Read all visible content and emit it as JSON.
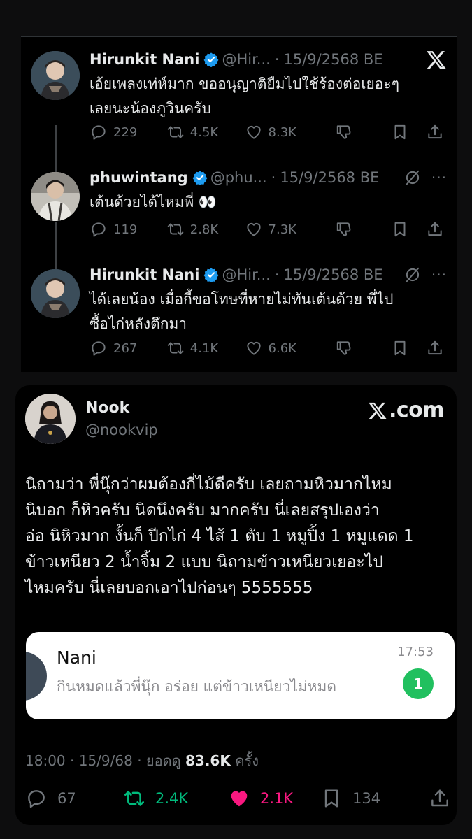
{
  "thread": {
    "tweets": [
      {
        "name": "Hirunkit Nani",
        "handle": "@Hir...",
        "date": "15/9/2568 BE",
        "text_lines": [
          "เอ้ยเพลงเท่ห์มาก ขออนุญาติยืมไปใช้ร้องต่อเยอะๆ",
          "เลยนะน้องภูวินครับ"
        ],
        "replies": "229",
        "reposts": "4.5K",
        "likes": "8.3K",
        "corner_icon": "x-logo-icon"
      },
      {
        "name": "phuwintang",
        "handle": "@phu...",
        "date": "15/9/2568 BE",
        "text_lines": [
          "เต้นด้วยได้ไหมพี่ 👀"
        ],
        "replies": "119",
        "reposts": "2.8K",
        "likes": "7.3K",
        "corner_icon": "grok-icon"
      },
      {
        "name": "Hirunkit Nani",
        "handle": "@Hir...",
        "date": "15/9/2568 BE",
        "text_lines": [
          "ได้เลยน้อง เมื่อกี้ขอโทษที่หายไม่ทันเต้นด้วย พี่ไป",
          "ซื้อไก่หลังตึกมา"
        ],
        "replies": "267",
        "reposts": "4.1K",
        "likes": "6.6K",
        "corner_icon": "grok-icon"
      }
    ],
    "dot": "·",
    "more": "···"
  },
  "nook": {
    "name": "Nook",
    "handle": "@nookvip",
    "site": ".com",
    "text_lines": [
      "นิถามว่า พี่นุ๊กว่าผมต้องกี่ไม้ดีครับ เลยถามหิวมากไหม",
      "นิบอก ก็หิวครับ นิดนึงครับ มากครับ นี่เลยสรุปเองว่า",
      "อ่อ นิหิวมาก งั้นก็ ปีกไก่ 4 ไส้ 1 ตับ 1 หมูปิ้ง 1 หมูแดด 1",
      "ข้าวเหนียว 2 น้ำจิ้ม 2 แบบ นิถามข้าวเหนียวเยอะไป",
      "ไหมครับ นี่เลยบอกเอาไปก่อนๆ 5555555"
    ],
    "notification": {
      "title": "Nani",
      "message": "กินหมดแล้วพี่นุ๊ก อร่อย แต่ข้าวเหนียวไม่หมด",
      "time": "17:53",
      "badge": "1"
    },
    "meta": {
      "time": "18:00",
      "dot1": "·",
      "date": "15/9/68",
      "dot2": "·",
      "views_label": "ยอดดู",
      "views": "83.6K",
      "views_suffix": "ครั้ง"
    },
    "actions": {
      "replies": "67",
      "reposts": "2.4K",
      "likes": "2.1K",
      "bookmarks": "134"
    }
  },
  "colors": {
    "background": "#0d0d0e",
    "card": "#000000",
    "text": "#e7e9ea",
    "muted": "#71767b",
    "verified": "#1d9bf0",
    "repost_active": "#00ba7c",
    "like_active": "#f91880",
    "badge": "#21c05f"
  }
}
